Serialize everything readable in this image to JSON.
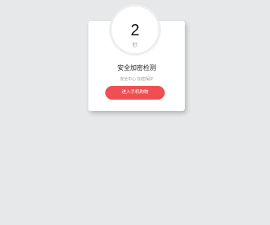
{
  "countdown": {
    "value": "2",
    "unit": "秒"
  },
  "dialog": {
    "title": "安全加密检测",
    "subtitle": "安全中心 加密保护",
    "button_label": "进入手机购物"
  },
  "colors": {
    "background": "#e6e8e9",
    "card": "#ffffff",
    "button": "#ef4f52"
  }
}
